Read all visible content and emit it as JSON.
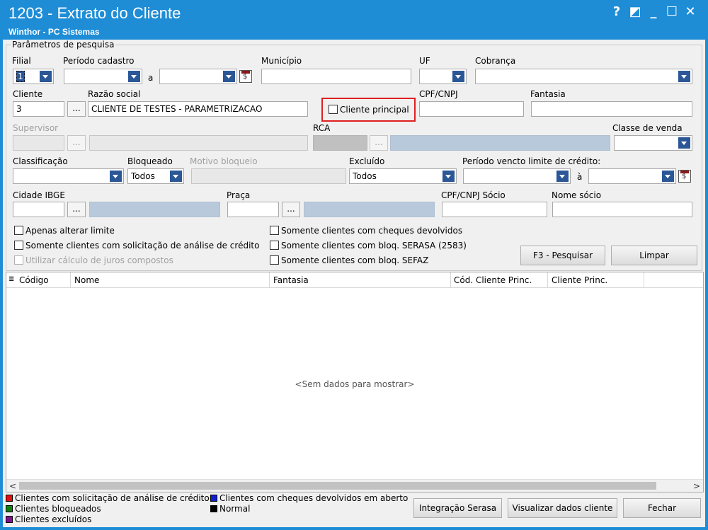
{
  "window": {
    "title": "1203 - Extrato do Cliente",
    "subtitle": "Winthor - PC Sistemas",
    "controls": {
      "help": "?",
      "restore": "◩",
      "minimize": "_",
      "maximize": "☐",
      "close": "✕"
    }
  },
  "params": {
    "group_title": "Parâmetros de pesquisa",
    "filial": {
      "label": "Filial",
      "value": "1"
    },
    "periodo_cadastro": {
      "label": "Período cadastro",
      "sep": "a"
    },
    "municipio": {
      "label": "Município",
      "value": ""
    },
    "uf": {
      "label": "UF",
      "value": ""
    },
    "cobranca": {
      "label": "Cobrança",
      "value": ""
    },
    "cliente": {
      "label": "Cliente",
      "value": "3",
      "lookup": "..."
    },
    "razao_social": {
      "label": "Razão social",
      "value": "CLIENTE DE TESTES - PARAMETRIZACAO"
    },
    "cliente_principal": {
      "label": "Cliente principal",
      "checked": false
    },
    "cpf_cnpj": {
      "label": "CPF/CNPJ",
      "value": ""
    },
    "fantasia": {
      "label": "Fantasia",
      "value": ""
    },
    "supervisor": {
      "label": "Supervisor",
      "lookup": "..."
    },
    "rca": {
      "label": "RCA",
      "lookup": "..."
    },
    "classe_venda": {
      "label": "Classe de venda",
      "value": ""
    },
    "classificacao": {
      "label": "Classificação",
      "value": ""
    },
    "bloqueado": {
      "label": "Bloqueado",
      "value": "Todos"
    },
    "motivo_bloqueio": {
      "label": "Motivo bloqueio"
    },
    "excluido": {
      "label": "Excluído",
      "value": "Todos"
    },
    "periodo_vencto": {
      "label": "Período vencto limite de crédito:",
      "sep": "à"
    },
    "cidade_ibge": {
      "label": "Cidade IBGE",
      "lookup": "..."
    },
    "praca": {
      "label": "Praça",
      "lookup": "..."
    },
    "cpf_cnpj_socio": {
      "label": "CPF/CNPJ Sócio",
      "value": ""
    },
    "nome_socio": {
      "label": "Nome sócio",
      "value": ""
    },
    "checks": {
      "apenas_alterar_limite": "Apenas alterar limite",
      "solicitacao_analise": "Somente clientes com solicitação de análise de crédito",
      "juros_compostos": "Utilizar cálculo de juros compostos",
      "cheques_devolvidos": "Somente clientes com cheques devolvidos",
      "bloq_serasa": "Somente clientes com bloq. SERASA (2583)",
      "bloq_sefaz": "Somente clientes com bloq. SEFAZ"
    },
    "buttons": {
      "pesquisar": "F3 - Pesquisar",
      "limpar": "Limpar"
    }
  },
  "grid": {
    "columns": [
      "Código",
      "Nome",
      "Fantasia",
      "Cód. Cliente Princ.",
      "Cliente Princ."
    ],
    "empty_text": "<Sem dados para mostrar>",
    "scroll_left": "<",
    "scroll_right": ">"
  },
  "legend": [
    {
      "label": "Clientes com solicitação de análise de crédito",
      "color": "#e01010"
    },
    {
      "label": "Clientes bloqueados",
      "color": "#108010"
    },
    {
      "label": "Clientes excluídos",
      "color": "#801090"
    },
    {
      "label": "Clientes com cheques devolvidos em aberto",
      "color": "#1020d0"
    },
    {
      "label": "Normal",
      "color": "#000000"
    }
  ],
  "footer_buttons": {
    "integracao_serasa": "Integração Serasa",
    "visualizar": "Visualizar dados cliente",
    "fechar": "Fechar"
  }
}
